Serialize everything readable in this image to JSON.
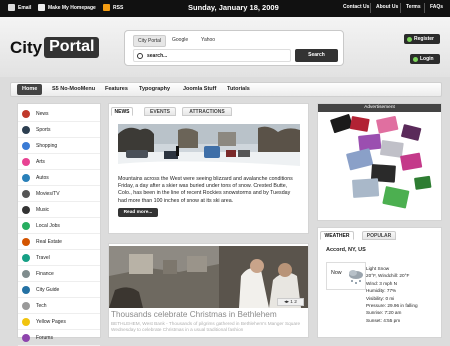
{
  "topbar": {
    "email": "Email",
    "homepage": "Make My Homepage",
    "rss": "RSS",
    "date": "Sunday, January 18, 2009",
    "links": [
      "Contact Us",
      "About Us",
      "Terms",
      "FAQs"
    ]
  },
  "logo": {
    "city": "City",
    "portal": "Portal"
  },
  "search": {
    "tabs": [
      "City Portal",
      "Google",
      "Yahoo"
    ],
    "placeholder": "search...",
    "button": "Search"
  },
  "account": {
    "register": "Register",
    "login": "Login"
  },
  "nav": [
    "Home",
    "S5 No-MooMenu",
    "Features",
    "Typography",
    "Joomla Stuff",
    "Tutorials"
  ],
  "sidebar": [
    {
      "label": "News",
      "icon": "news-icon",
      "color": "#c0392b"
    },
    {
      "label": "Sports",
      "icon": "sports-icon",
      "color": "#2c3e50"
    },
    {
      "label": "Shopping",
      "icon": "shopping-icon",
      "color": "#3a7bd5"
    },
    {
      "label": "Arts",
      "icon": "arts-icon",
      "color": "#e84393"
    },
    {
      "label": "Autos",
      "icon": "autos-icon",
      "color": "#2980b9"
    },
    {
      "label": "Movies/TV",
      "icon": "movies-icon",
      "color": "#555555"
    },
    {
      "label": "Music",
      "icon": "music-icon",
      "color": "#333333"
    },
    {
      "label": "Local Jobs",
      "icon": "jobs-icon",
      "color": "#27ae60"
    },
    {
      "label": "Real Estate",
      "icon": "realestate-icon",
      "color": "#d35400"
    },
    {
      "label": "Travel",
      "icon": "travel-icon",
      "color": "#16a085"
    },
    {
      "label": "Finance",
      "icon": "finance-icon",
      "color": "#7f8c8d"
    },
    {
      "label": "City Guide",
      "icon": "cityguide-icon",
      "color": "#2471a3"
    },
    {
      "label": "Tech",
      "icon": "tech-icon",
      "color": "#999999"
    },
    {
      "label": "Yellow Pages",
      "icon": "yellowpages-icon",
      "color": "#f1c40f"
    },
    {
      "label": "Forums",
      "icon": "forums-icon",
      "color": "#8e44ad"
    }
  ],
  "news": {
    "tabs": [
      "NEWS",
      "EVENTS",
      "ATTRACTIONS"
    ],
    "lines": [
      "Mountains across the West were seeing blizzard and avalanche conditions",
      "Friday, a day after a skier was buried under tons of snow. Crested Butte,",
      "Colo., has been in the line of recent Rockies snowstorms and by Tuesday",
      "had more than 100 inches of snow at its ski area."
    ],
    "readmore": "Read more..."
  },
  "feature": {
    "pager": "1   2",
    "title": "Thousands celebrate Christmas in Bethlehem",
    "text": "BETHLEHEM, West Bank - Thousands of pilgrims gathered in Bethlehem's Manger Square Wednesday to celebrate Christmas in a usual traditional fashion"
  },
  "ad": {
    "label": "Advertisement"
  },
  "weather": {
    "tabs": [
      "WEATHER",
      "POPULAR"
    ],
    "location": "Accord, NY, US",
    "now": "Now",
    "details": [
      "Light Snow",
      "20°F, Windchill: 20°F",
      "Wind: 3 mph N",
      "Humidity: 77%",
      "Visibility: 0 mi",
      "Pressure: 29.96 in falling",
      "Sunrise: 7:20 am",
      "Sunset: 4:55 pm"
    ]
  }
}
